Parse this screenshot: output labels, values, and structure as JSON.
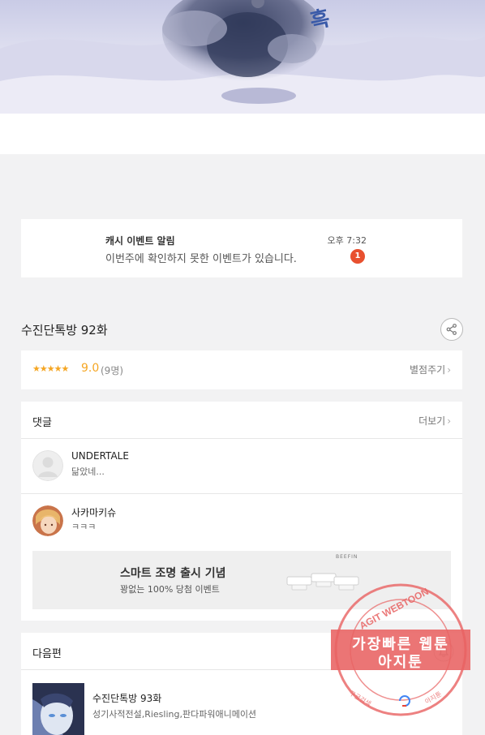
{
  "hero": {
    "caption_char": "흑"
  },
  "notice": {
    "title": "캐시 이벤트 알림",
    "message": "이번주에 확인하지 못한 이벤트가 있습니다.",
    "time": "오후 7:32",
    "badge_count": "1"
  },
  "episode": {
    "title": "수진단톡방 92화",
    "share_icon": "share-icon"
  },
  "rating": {
    "stars": "★★★★★",
    "score": "9.0",
    "count": "(9명)",
    "rate_button": "별점주기"
  },
  "comments": {
    "header": "댓글",
    "more": "더보기",
    "items": [
      {
        "name": "UNDERTALE",
        "text": "닮았네..."
      },
      {
        "name": "사카마키슈",
        "text": "ㅋㅋㅋ"
      }
    ]
  },
  "ad": {
    "title": "스마트 조명 출시 기념",
    "subtitle": "꽝없는 100% 당첨 이벤트",
    "brand": "BEEFIN"
  },
  "next": {
    "header": "다음편",
    "episode": "수진단톡방 93화",
    "authors": "성기사적전설,Riesling,판다파워애니메이션"
  },
  "watermark": {
    "arc_text": "AGIT WEBTOON",
    "line1": "가장빠른 웹툰",
    "line2": "아지툰",
    "small_left": "구글검색",
    "small_right": "아지툰"
  },
  "colors": {
    "star": "#f5a623",
    "badge": "#e8502f",
    "stamp": "#e86262"
  }
}
